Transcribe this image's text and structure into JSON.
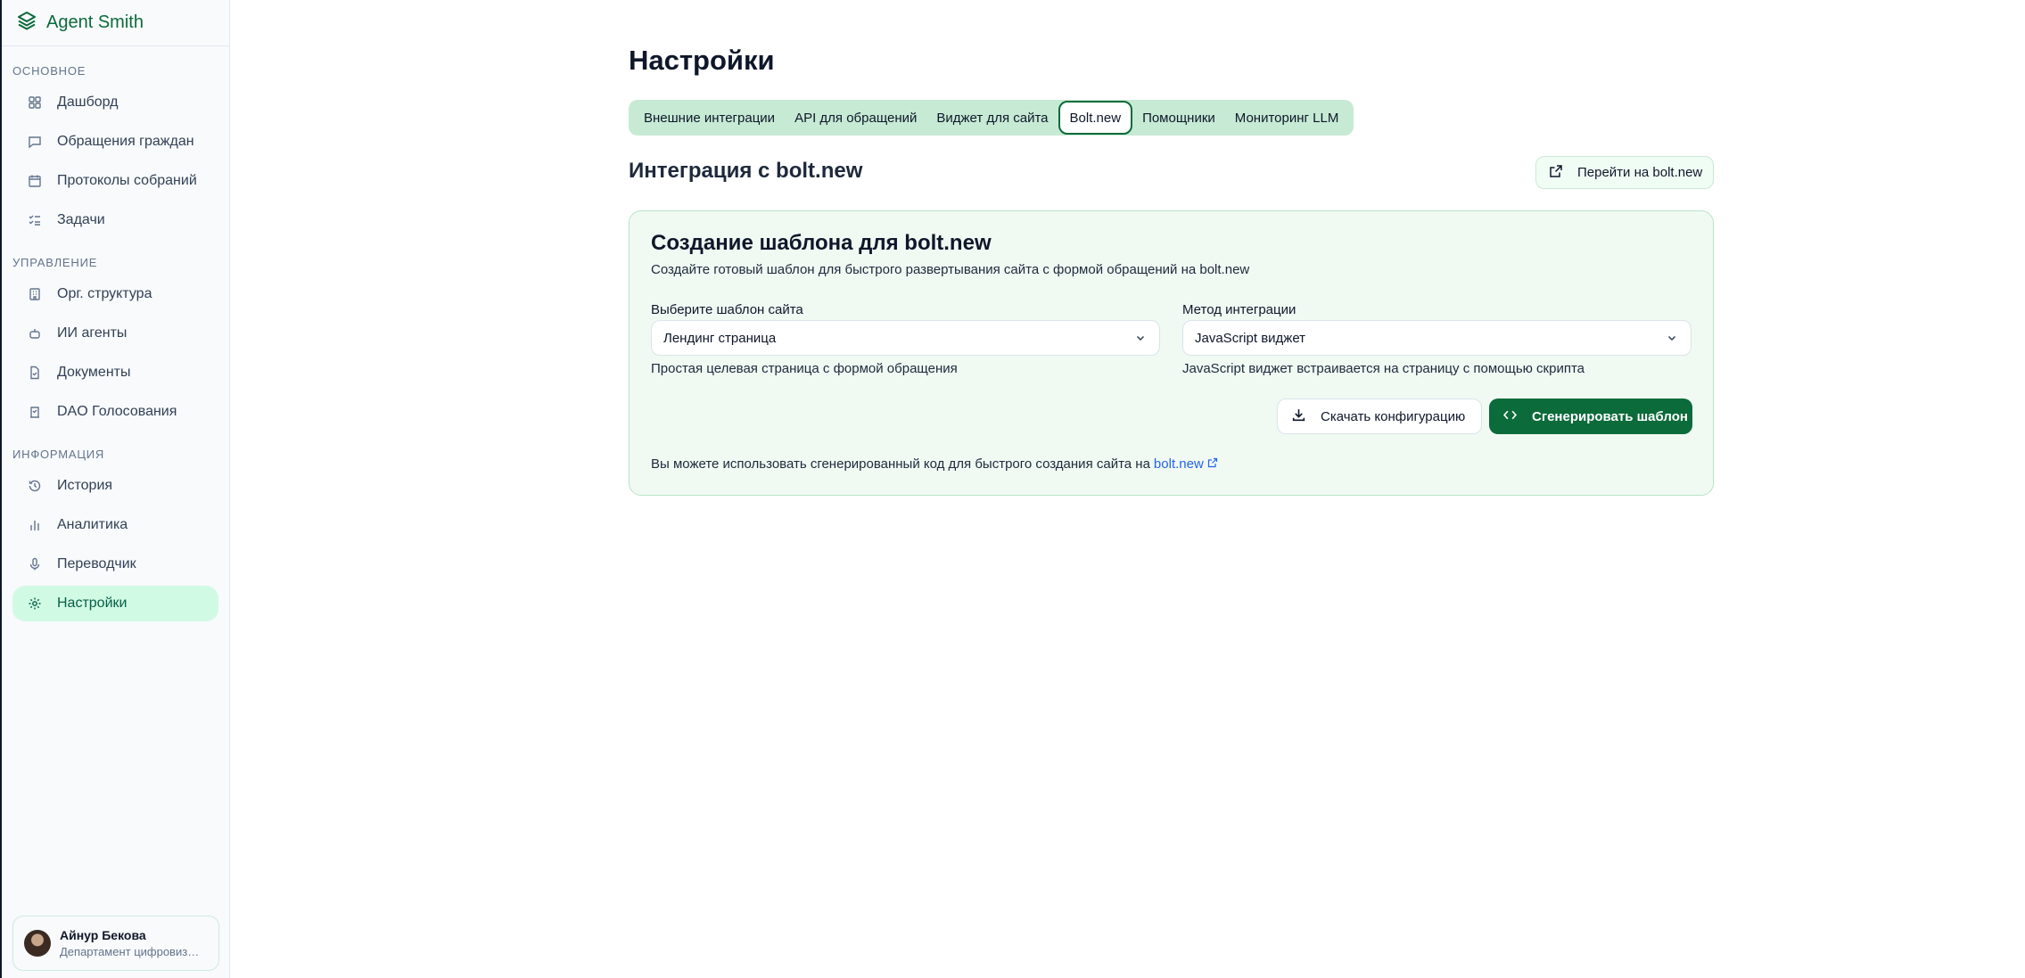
{
  "app": {
    "name": "Agent Smith"
  },
  "sidebar": {
    "sections": [
      {
        "title": "Основное",
        "items": [
          {
            "label": "Дашборд",
            "icon": "grid-icon"
          },
          {
            "label": "Обращения граждан",
            "icon": "message-icon"
          },
          {
            "label": "Протоколы собраний",
            "icon": "calendar-icon"
          },
          {
            "label": "Задачи",
            "icon": "list-check-icon"
          }
        ]
      },
      {
        "title": "Управление",
        "items": [
          {
            "label": "Орг. структура",
            "icon": "building-icon"
          },
          {
            "label": "ИИ агенты",
            "icon": "bot-icon"
          },
          {
            "label": "Документы",
            "icon": "document-icon"
          },
          {
            "label": "DAO Голосования",
            "icon": "vote-icon"
          }
        ]
      },
      {
        "title": "Информация",
        "items": [
          {
            "label": "История",
            "icon": "history-icon"
          },
          {
            "label": "Аналитика",
            "icon": "chart-icon"
          },
          {
            "label": "Переводчик",
            "icon": "mic-icon"
          },
          {
            "label": "Настройки",
            "icon": "gear-icon",
            "active": true
          }
        ]
      }
    ],
    "user": {
      "name": "Айнур Бекова",
      "department": "Департамент цифровизации"
    }
  },
  "page": {
    "title": "Настройки",
    "tabs": [
      {
        "label": "Внешние интеграции"
      },
      {
        "label": "API для обращений"
      },
      {
        "label": "Виджет для сайта"
      },
      {
        "label": "Bolt.new",
        "active": true
      },
      {
        "label": "Помощники"
      },
      {
        "label": "Мониторинг LLM"
      }
    ],
    "section_title": "Интеграция с bolt.new",
    "goto_button": "Перейти на bolt.new"
  },
  "card": {
    "title": "Создание шаблона для bolt.new",
    "subtitle": "Создайте готовый шаблон для быстрого развертывания сайта с формой обращений на bolt.new",
    "template_label": "Выберите шаблон сайта",
    "template_value": "Лендинг страница",
    "template_hint": "Простая целевая страница с формой обращения",
    "method_label": "Метод интеграции",
    "method_value": "JavaScript виджет",
    "method_hint": "JavaScript виджет встраивается на страницу с помощью скрипта",
    "download_button": "Скачать конфигурацию",
    "generate_button": "Сгенерировать шаблон",
    "footnote": "Вы можете использовать сгенерированный код для быстрого создания сайта на",
    "footnote_link": "bolt.new"
  },
  "colors": {
    "accent": "#0b6b3a",
    "tabs_bg": "#c6ead4",
    "active_nav": "#d1fae5",
    "link": "#2563eb"
  }
}
